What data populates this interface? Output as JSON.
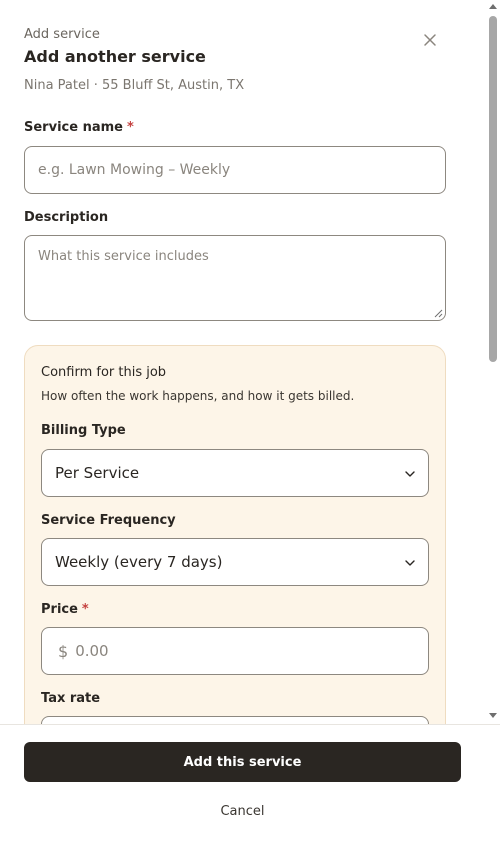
{
  "header": {
    "eyebrow": "Add service",
    "title": "Add another service",
    "customer": "Nina Patel · 55 Bluff St, Austin, TX",
    "close_icon": "close-icon"
  },
  "form": {
    "service_name": {
      "label": "Service name",
      "required_mark": "*",
      "value": "",
      "placeholder": "e.g. Lawn Mowing – Weekly"
    },
    "description": {
      "label": "Description",
      "value": "",
      "placeholder": "What this service includes"
    }
  },
  "confirm": {
    "title": "Confirm for this job",
    "description": "How often the work happens, and how it gets billed.",
    "billing_type": {
      "label": "Billing Type",
      "selected": "Per Service"
    },
    "service_frequency": {
      "label": "Service Frequency",
      "selected": "Weekly (every 7 days)"
    },
    "price": {
      "label": "Price",
      "required_mark": "*",
      "currency": "$",
      "value": "",
      "placeholder": "0.00"
    },
    "tax_rate": {
      "label": "Tax rate"
    }
  },
  "footer": {
    "submit_label": "Add this service",
    "cancel_label": "Cancel"
  },
  "colors": {
    "primary": "#2a2622",
    "required": "#c4413f",
    "card_background": "#fdf5e8",
    "card_border": "#efdcc0"
  }
}
